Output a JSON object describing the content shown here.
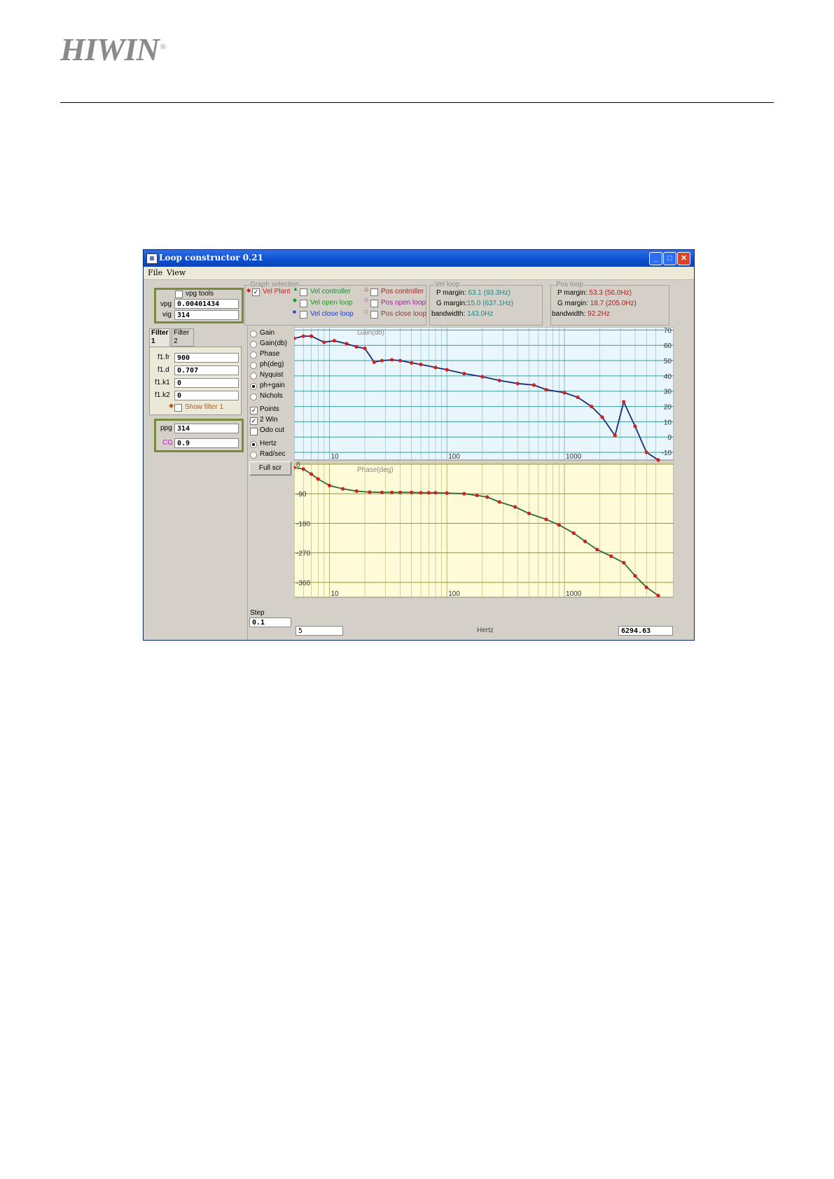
{
  "document": {
    "logo": "HIWIN",
    "logo_mark": "®"
  },
  "window": {
    "title": "Loop constructor 0.21",
    "menu": [
      "File",
      "View"
    ],
    "controls": {
      "minimize": "_",
      "maximize": "□",
      "close": "✕"
    }
  },
  "left_panel": {
    "vpg_tools_label": "vpg tools",
    "vpg_label": "vpg",
    "vpg_value": "0.00401434",
    "vig_label": "vig",
    "vig_value": "314",
    "tabs": [
      "Filter 1",
      "Filter 2"
    ],
    "filter_fields": [
      {
        "label": "f1.fr",
        "value": "900"
      },
      {
        "label": "f1.d",
        "value": "0.707"
      },
      {
        "label": "f1.k1",
        "value": "0"
      },
      {
        "label": "f1.k2",
        "value": "0"
      }
    ],
    "show_filter_label": "Show filter 1",
    "ppg_label": "ppg",
    "ppg_value": "314",
    "cg_label": "CG",
    "cg_value": "0.9"
  },
  "graph_selection": {
    "legend": "Graph selection",
    "vel_plant": "Vel Plant",
    "vel_controller": "Vel controller",
    "vel_open_loop": "Vel open loop",
    "vel_close_loop": "Vel close loop",
    "pos_controller": "Pos controller",
    "pos_open_loop": "Pos open loop",
    "pos_close_loop": "Pos close loop"
  },
  "vel_loop": {
    "legend": "Vel loop",
    "p_margin_label": "P margin:",
    "p_margin_value": "63.1 (93.3Hz)",
    "g_margin_label": "G margin:",
    "g_margin_value": "15.0 (637.1Hz)",
    "bandwidth_label": "bandwidth:",
    "bandwidth_value": "143.0Hz"
  },
  "pos_loop": {
    "legend": "Pos loop",
    "p_margin_label": "P margin:",
    "p_margin_value": "53.3 (56.0Hz)",
    "g_margin_label": "G margin:",
    "g_margin_value": "18.7 (205.0Hz)",
    "bandwidth_label": "bandwidth:",
    "bandwidth_value": "92.2Hz"
  },
  "options": {
    "radios": [
      "Gain",
      "Gain(db)",
      "Phase",
      "ph(deg)",
      "Nyquist",
      "ph+gain",
      "Nichols"
    ],
    "checks": [
      "Points",
      "2 Win",
      "Odo cut"
    ],
    "units": [
      "Hertz",
      "Rad/sec"
    ],
    "full_scr": "Full scr",
    "step_label": "Step",
    "step_value": "0.1"
  },
  "footer": {
    "freq_min": "5",
    "freq_label": "Hertz",
    "freq_max": "6294.63"
  },
  "chart_data": [
    {
      "type": "line",
      "title": "Gain(db)",
      "xscale": "log",
      "xlim": [
        5,
        6294.63
      ],
      "ylim": [
        -15,
        72
      ],
      "xticks": [
        "10",
        "100",
        "1000"
      ],
      "yticks": [
        "70",
        "60",
        "50",
        "40",
        "30",
        "20",
        "10",
        "0",
        "-10"
      ],
      "grid": true,
      "series": [
        {
          "line_color": "#1a2a7a",
          "point_color": "#d42020",
          "x": [
            5,
            6,
            7,
            9,
            11,
            14,
            17,
            20,
            24,
            28,
            34,
            40,
            50,
            60,
            80,
            100,
            140,
            200,
            280,
            400,
            550,
            700,
            1000,
            1300,
            1700,
            2100,
            2700,
            3200,
            4000,
            5000,
            6294.63
          ],
          "y": [
            64.5,
            66,
            66,
            62,
            63,
            61,
            59,
            58,
            49,
            50,
            50.5,
            50,
            48.5,
            47.5,
            45.5,
            44,
            41.5,
            39.5,
            37,
            35,
            34,
            31,
            29,
            26,
            20,
            13,
            1,
            23,
            7,
            -10,
            -15
          ]
        }
      ]
    },
    {
      "type": "line",
      "title": "Phase(deg)",
      "xscale": "log",
      "xlim": [
        5,
        6294.63
      ],
      "ylim": [
        -405,
        0
      ],
      "xticks": [
        "10",
        "100",
        "1000"
      ],
      "yticks": [
        "0",
        "-90",
        "-180",
        "-270",
        "-360"
      ],
      "grid": true,
      "series": [
        {
          "line_color": "#2e6b2e",
          "point_color": "#d42020",
          "x": [
            5,
            6,
            7,
            8,
            10,
            13,
            17,
            22,
            28,
            34,
            40,
            50,
            60,
            70,
            80,
            100,
            140,
            180,
            220,
            280,
            380,
            500,
            700,
            900,
            1200,
            1500,
            1900,
            2500,
            3200,
            4000,
            5000,
            6294.63
          ],
          "y": [
            -10,
            -15,
            -30,
            -45,
            -65,
            -75,
            -82,
            -85,
            -86,
            -86,
            -86,
            -86,
            -87,
            -87,
            -87,
            -88,
            -90,
            -95,
            -100,
            -115,
            -130,
            -150,
            -168,
            -185,
            -210,
            -235,
            -260,
            -280,
            -300,
            -340,
            -375,
            -400
          ]
        }
      ]
    }
  ]
}
